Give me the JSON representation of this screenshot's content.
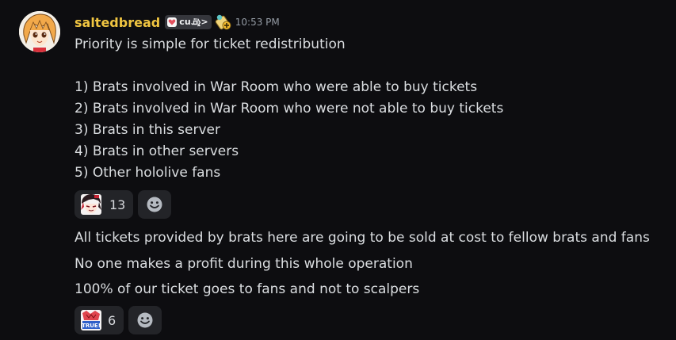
{
  "message": {
    "author": {
      "username": "saltedbread",
      "tag_text": "cuܩ̈⦊ͅ>",
      "timestamp": "10:53 PM"
    },
    "block1_lines": [
      "Priority is simple for ticket redistribution",
      "",
      "1) Brats involved in War Room who were able to buy tickets",
      "2) Brats involved in War Room who were not able to buy tickets",
      "3) Brats in this server",
      "4) Brats in other servers",
      "5) Other hololive fans"
    ],
    "reactions1": [
      {
        "count": "13"
      }
    ],
    "block2_lines": [
      "All tickets provided by brats here are going to be sold at cost to fellow brats and fans",
      "No one makes a profit during this whole operation",
      "100% of our ticket goes to fans and not to scalpers"
    ],
    "reactions2": [
      {
        "count": "6",
        "emoji_text": "TRUE!"
      }
    ]
  },
  "icons": {
    "avatar": "anime-girl-avatar",
    "tag_icon": "heart-tag-icon",
    "role_icon": "plus-badge-icon",
    "add_reaction": "smiley-add-reaction-icon"
  },
  "colors": {
    "background": "#0d0d10",
    "username": "#f0c541",
    "text": "#dbdee1",
    "timestamp": "#949ba4",
    "reaction_bg": "#232428"
  }
}
